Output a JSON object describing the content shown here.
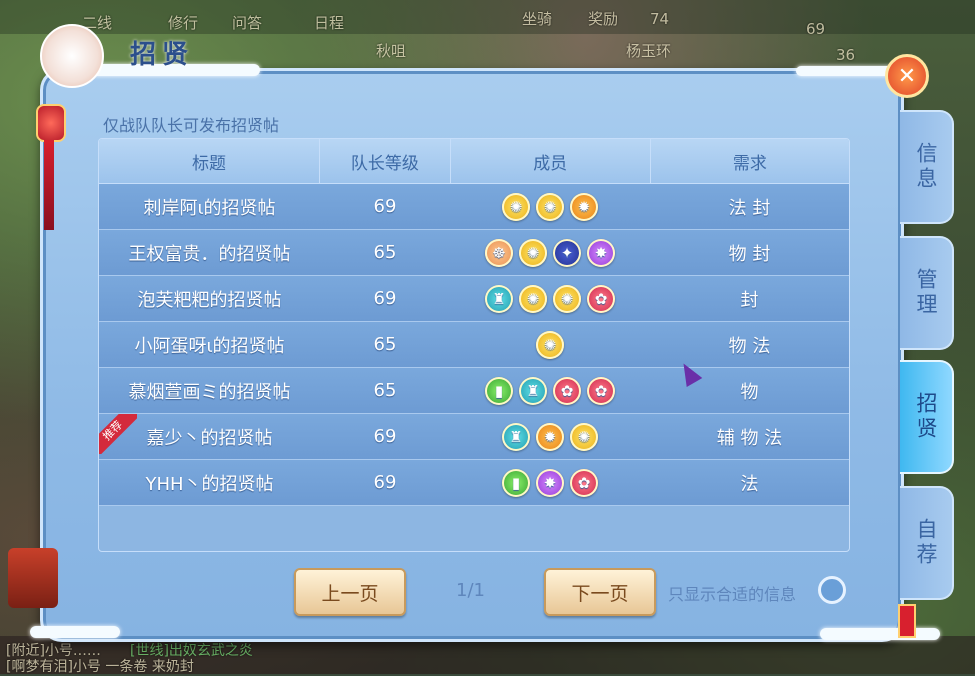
{
  "window": {
    "title": "招贤",
    "close_icon": "close-icon"
  },
  "notice": "仅战队队长可发布招贤帖",
  "table": {
    "headers": [
      "标题",
      "队长等级",
      "成员",
      "需求"
    ],
    "rows": [
      {
        "title": "刺岸阿ι的招贤帖",
        "level": "69",
        "members": [
          "yellow",
          "yellow",
          "orange"
        ],
        "need": "法 封",
        "recommended": false
      },
      {
        "title": "王权富贵．的招贤帖",
        "level": "65",
        "members": [
          "peach",
          "yellow",
          "blue",
          "purple"
        ],
        "need": "物 封",
        "recommended": false
      },
      {
        "title": "泡芙粑粑的招贤帖",
        "level": "69",
        "members": [
          "teal",
          "yellow",
          "yellow",
          "red"
        ],
        "need": "封",
        "recommended": false
      },
      {
        "title": "小阿蛋呀ι的招贤帖",
        "level": "65",
        "members": [
          "yellow"
        ],
        "need": "物 法",
        "recommended": false
      },
      {
        "title": "慕烟萱画ミ的招贤帖",
        "level": "65",
        "members": [
          "green",
          "teal",
          "red",
          "red"
        ],
        "need": "物",
        "recommended": false
      },
      {
        "title": "嘉少丶的招贤帖",
        "level": "69",
        "members": [
          "teal",
          "orange",
          "yellow"
        ],
        "need": "辅 物 法",
        "recommended": true
      },
      {
        "title": "YHH丶的招贤帖",
        "level": "69",
        "members": [
          "green",
          "purple",
          "red"
        ],
        "need": "法",
        "recommended": false
      }
    ],
    "recommend_badge": "推荐"
  },
  "pagination": {
    "prev_label": "上一页",
    "next_label": "下一页",
    "page": "1/1"
  },
  "filter": {
    "label": "只显示合适的信息",
    "checked": false
  },
  "side_tabs": [
    {
      "label": "信息",
      "active": false
    },
    {
      "label": "管理",
      "active": false
    },
    {
      "label": "招贤",
      "active": true
    },
    {
      "label": "自荐",
      "active": false
    }
  ],
  "background": {
    "top_texts": [
      "二线",
      "修行",
      "问答",
      "日程",
      "坐骑",
      "奖励",
      "74",
      "69",
      "36",
      "秋咀",
      "杨玉环"
    ],
    "bottom_texts": [
      "[附近]小号……",
      "[世线]出奴玄武之炎",
      "[啊梦有泪]小号 一条卷 来奶封"
    ]
  }
}
